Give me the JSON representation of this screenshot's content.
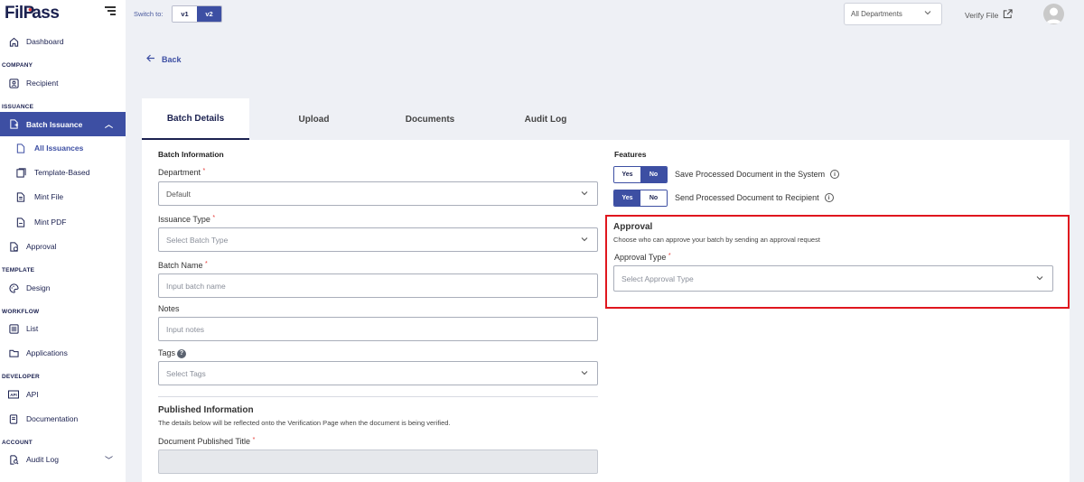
{
  "app": {
    "logo_prefix": "Fil",
    "logo_mark": "P",
    "logo_suffix": "ass"
  },
  "sidebar": {
    "items": [
      {
        "label": "Dashboard",
        "icon": "home-icon"
      },
      {
        "section": "COMPANY"
      },
      {
        "label": "Recipient",
        "icon": "contact-card-icon"
      },
      {
        "section": "ISSUANCE"
      },
      {
        "label": "Batch Issuance",
        "icon": "batch-doc-icon"
      },
      {
        "label": "All Issuances",
        "icon": "file-icon"
      },
      {
        "label": "Template-Based",
        "icon": "template-icon"
      },
      {
        "label": "Mint File",
        "icon": "document-icon"
      },
      {
        "label": "Mint PDF",
        "icon": "pdf-icon"
      },
      {
        "label": "Approval",
        "icon": "approval-doc-icon"
      },
      {
        "section": "TEMPLATE"
      },
      {
        "label": "Design",
        "icon": "palette-icon"
      },
      {
        "section": "WORKFLOW"
      },
      {
        "label": "List",
        "icon": "list-icon"
      },
      {
        "label": "Applications",
        "icon": "folder-icon"
      },
      {
        "section": "DEVELOPER"
      },
      {
        "label": "API",
        "icon": "api-icon"
      },
      {
        "label": "Documentation",
        "icon": "book-icon"
      },
      {
        "section": "ACCOUNT"
      },
      {
        "label": "Audit Log",
        "icon": "audit-search-icon"
      }
    ]
  },
  "topbar": {
    "switch_label": "Switch to:",
    "v1": "v1",
    "v2": "v2",
    "department": "All Departments",
    "verify": "Verify File"
  },
  "back": "Back",
  "tabs": [
    "Batch Details",
    "Upload",
    "Documents",
    "Audit Log"
  ],
  "form": {
    "batch_info": "Batch Information",
    "department_label": "Department",
    "department_value": "Default",
    "issuance_label": "Issuance Type",
    "issuance_placeholder": "Select Batch Type",
    "batch_name_label": "Batch Name",
    "batch_name_placeholder": "Input batch name",
    "notes_label": "Notes",
    "notes_placeholder": "Input notes",
    "tags_label": "Tags",
    "tags_placeholder": "Select Tags",
    "published_title": "Published Information",
    "published_desc": "The details below will be reflected onto the Verification Page when the document is being verified.",
    "doc_title_label": "Document Published Title",
    "required_mark": "*"
  },
  "features": {
    "title": "Features",
    "yes": "Yes",
    "no": "No",
    "save_label": "Save Processed Document in the System",
    "save_value": "No",
    "send_label": "Send Processed Document to Recipient",
    "send_value": "Yes"
  },
  "approval": {
    "title": "Approval",
    "desc": "Choose who can approve your batch by sending an approval request",
    "type_label": "Approval Type",
    "type_placeholder": "Select Approval Type"
  },
  "colors": {
    "primary": "#3d4fa3",
    "navy": "#1b2150",
    "highlight": "#e0161e",
    "required": "#e53935"
  }
}
